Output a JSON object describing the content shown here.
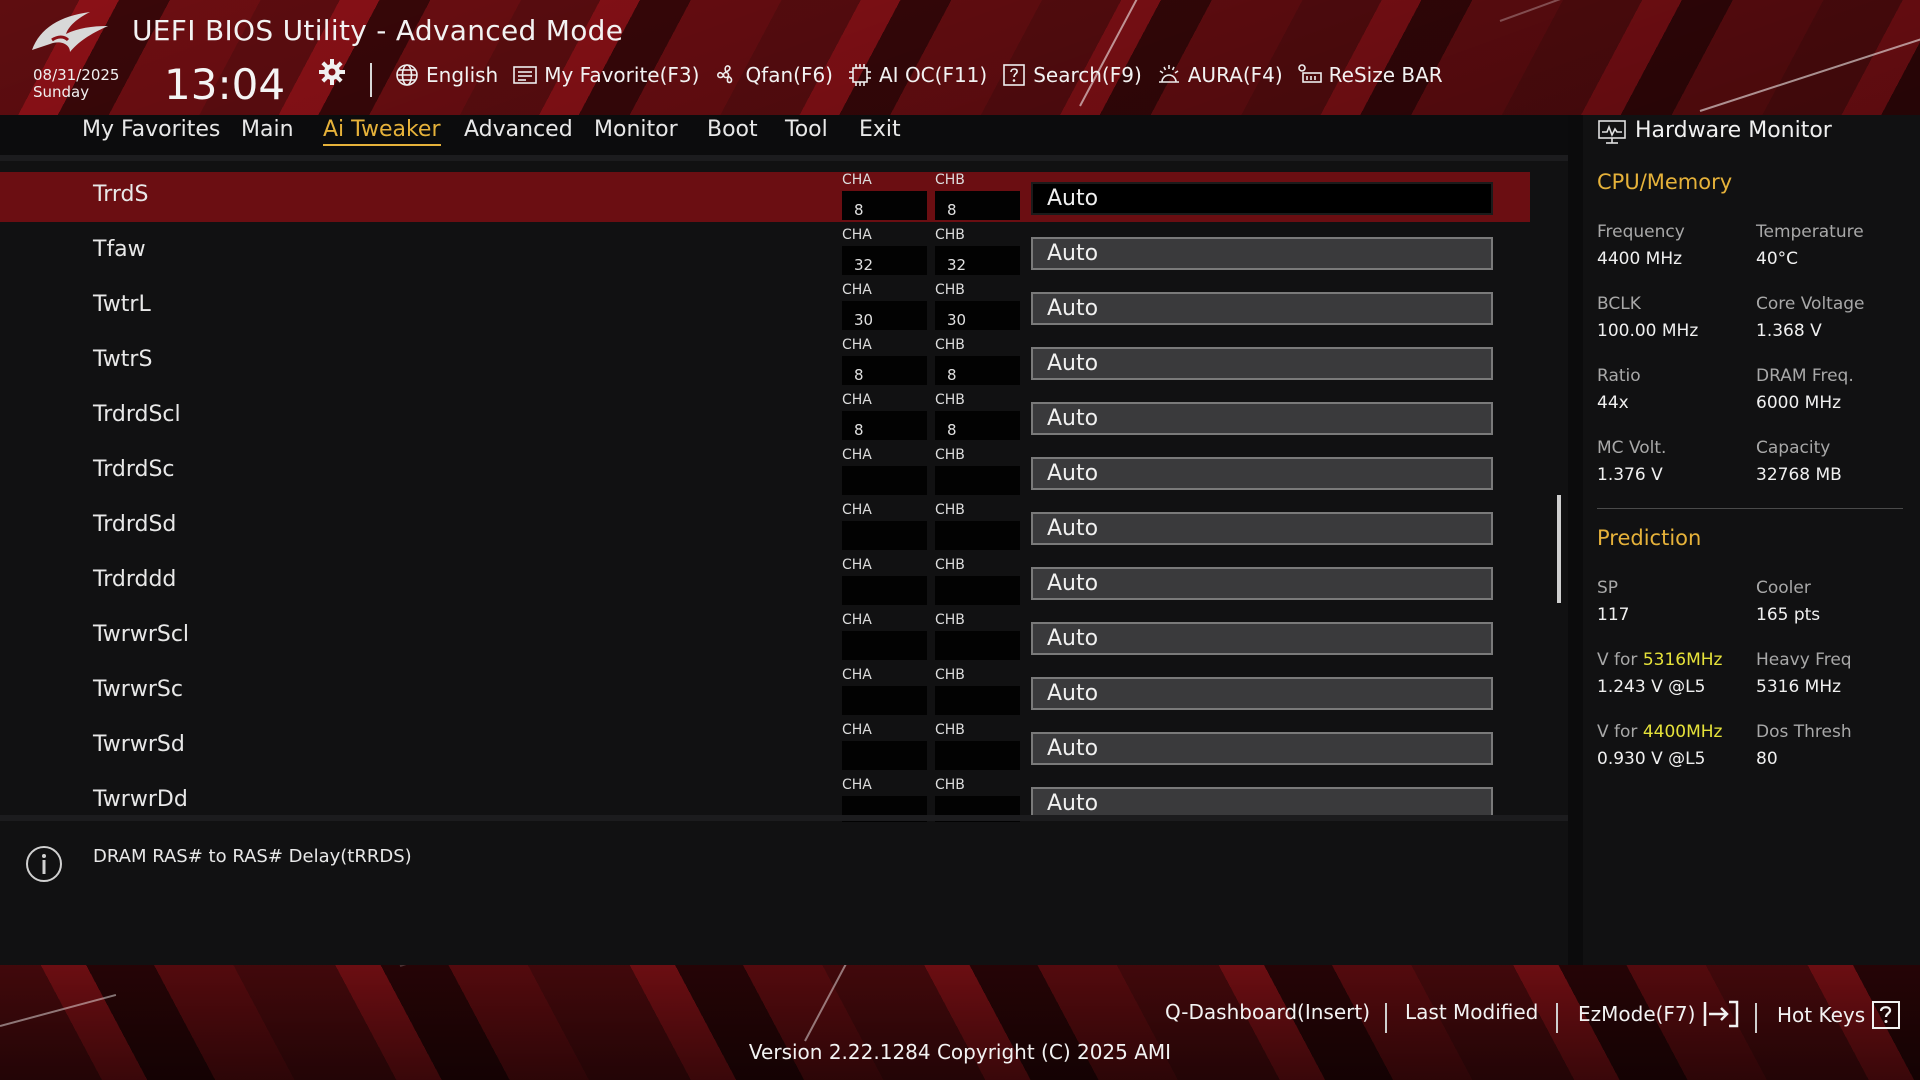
{
  "header": {
    "title": "UEFI BIOS Utility - Advanced Mode",
    "date": "08/31/2025",
    "day": "Sunday",
    "time": "13:04",
    "toolbar": [
      {
        "label": "English",
        "icon": "globe-icon"
      },
      {
        "label": "My Favorite(F3)",
        "icon": "favorite-list-icon"
      },
      {
        "label": "Qfan(F6)",
        "icon": "fan-icon"
      },
      {
        "label": "AI OC(F11)",
        "icon": "ai-chip-icon"
      },
      {
        "label": "Search(F9)",
        "icon": "search-question-icon"
      },
      {
        "label": "AURA(F4)",
        "icon": "aura-light-icon"
      },
      {
        "label": "ReSize BAR",
        "icon": "resize-bar-icon"
      }
    ]
  },
  "tabs": [
    {
      "label": "My Favorites",
      "active": false
    },
    {
      "label": "Main",
      "active": false
    },
    {
      "label": "Ai Tweaker",
      "active": true
    },
    {
      "label": "Advanced",
      "active": false
    },
    {
      "label": "Monitor",
      "active": false
    },
    {
      "label": "Boot",
      "active": false
    },
    {
      "label": "Tool",
      "active": false
    },
    {
      "label": "Exit",
      "active": false
    }
  ],
  "settings": {
    "cha_label": "CHA",
    "chb_label": "CHB",
    "rows": [
      {
        "name": "TrrdS",
        "cha": "8",
        "chb": "8",
        "value": "Auto",
        "selected": true
      },
      {
        "name": "Tfaw",
        "cha": "32",
        "chb": "32",
        "value": "Auto",
        "selected": false
      },
      {
        "name": "TwtrL",
        "cha": "30",
        "chb": "30",
        "value": "Auto",
        "selected": false
      },
      {
        "name": "TwtrS",
        "cha": "8",
        "chb": "8",
        "value": "Auto",
        "selected": false
      },
      {
        "name": "TrdrdScl",
        "cha": "8",
        "chb": "8",
        "value": "Auto",
        "selected": false
      },
      {
        "name": "TrdrdSc",
        "cha": "",
        "chb": "",
        "value": "Auto",
        "selected": false
      },
      {
        "name": "TrdrdSd",
        "cha": "",
        "chb": "",
        "value": "Auto",
        "selected": false
      },
      {
        "name": "Trdrddd",
        "cha": "",
        "chb": "",
        "value": "Auto",
        "selected": false
      },
      {
        "name": "TwrwrScl",
        "cha": "",
        "chb": "",
        "value": "Auto",
        "selected": false
      },
      {
        "name": "TwrwrSc",
        "cha": "",
        "chb": "",
        "value": "Auto",
        "selected": false
      },
      {
        "name": "TwrwrSd",
        "cha": "",
        "chb": "",
        "value": "Auto",
        "selected": false
      },
      {
        "name": "TwrwrDd",
        "cha": "",
        "chb": "",
        "value": "Auto",
        "selected": false
      }
    ]
  },
  "help": {
    "text": "DRAM RAS# to RAS# Delay(tRRDS)"
  },
  "hardware_monitor": {
    "title": "Hardware Monitor",
    "cpu_memory": {
      "heading": "CPU/Memory",
      "items": [
        {
          "key": "Frequency",
          "value": "4400 MHz"
        },
        {
          "key": "Temperature",
          "value": "40°C"
        },
        {
          "key": "BCLK",
          "value": "100.00 MHz"
        },
        {
          "key": "Core Voltage",
          "value": "1.368 V"
        },
        {
          "key": "Ratio",
          "value": "44x"
        },
        {
          "key": "DRAM Freq.",
          "value": "6000 MHz"
        },
        {
          "key": "MC Volt.",
          "value": "1.376 V"
        },
        {
          "key": "Capacity",
          "value": "32768 MB"
        }
      ]
    },
    "prediction": {
      "heading": "Prediction",
      "sp_key": "SP",
      "sp_value": "117",
      "cooler_key": "Cooler",
      "cooler_value": "165 pts",
      "v1_prefix": "V for ",
      "v1_freq": "5316MHz",
      "v1_value": "1.243 V @L5",
      "heavy_key": "Heavy Freq",
      "heavy_value": "5316 MHz",
      "v2_prefix": "V for ",
      "v2_freq": "4400MHz",
      "v2_value": "0.930 V @L5",
      "dos_key": "Dos Thresh",
      "dos_value": "80"
    }
  },
  "footer": {
    "q_dashboard": "Q-Dashboard(Insert)",
    "last_modified": "Last Modified",
    "ezmode": "EzMode(F7)",
    "hotkeys": "Hot Keys",
    "version": "Version 2.22.1284 Copyright (C) 2025 AMI"
  },
  "colors": {
    "accent": "#e6b23a",
    "selected_row": "#6b0e12",
    "highlight_freq": "#e6e23a",
    "panel_bg": "#111112"
  }
}
